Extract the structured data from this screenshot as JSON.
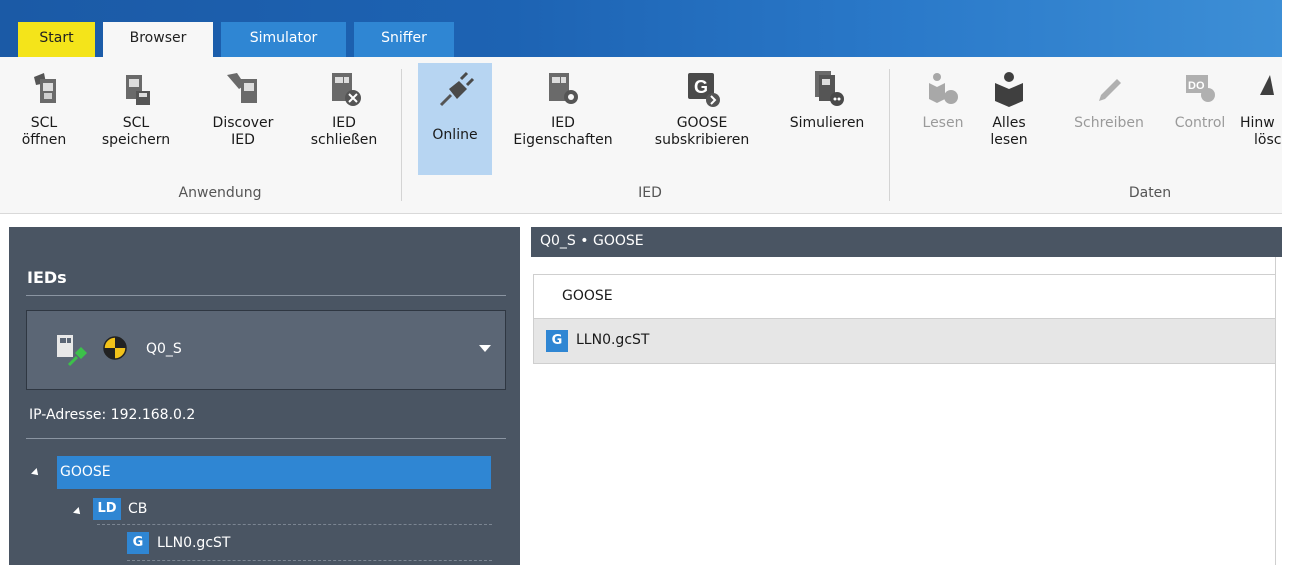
{
  "tabs": [
    "Start",
    "Browser",
    "Simulator",
    "Sniffer"
  ],
  "ribbon": {
    "anwendung": {
      "group_label": "Anwendung",
      "buttons": [
        {
          "icon": "open-scl-icon",
          "line1": "SCL",
          "line2": "öffnen"
        },
        {
          "icon": "save-scl-icon",
          "line1": "SCL",
          "line2": "speichern"
        },
        {
          "icon": "discover-ied-icon",
          "line1": "Discover",
          "line2": "IED"
        },
        {
          "icon": "close-ied-icon",
          "line1": "IED",
          "line2": "schließen"
        }
      ]
    },
    "ied": {
      "group_label": "IED",
      "buttons": [
        {
          "icon": "plug-icon",
          "line1": "Online",
          "line2": ""
        },
        {
          "icon": "ied-properties-icon",
          "line1": "IED",
          "line2": "Eigenschaften"
        },
        {
          "icon": "goose-subscribe-icon",
          "line1": "GOOSE",
          "line2": "subskribieren"
        },
        {
          "icon": "simulate-icon",
          "line1": "Simulieren",
          "line2": ""
        }
      ]
    },
    "daten": {
      "group_label": "Daten",
      "buttons": [
        {
          "icon": "read-icon",
          "line1": "Lesen",
          "line2": ""
        },
        {
          "icon": "read-all-icon",
          "line1": "Alles",
          "line2": "lesen"
        },
        {
          "icon": "write-icon",
          "line1": "Schreiben",
          "line2": ""
        },
        {
          "icon": "control-icon",
          "line1": "Control",
          "line2": ""
        },
        {
          "icon": "delete-hints-icon",
          "line1": "Hinw",
          "line2": "lösc"
        }
      ]
    }
  },
  "left": {
    "title": "IEDs",
    "selected_ied": "Q0_S",
    "ip_label": "IP-Adresse:",
    "ip_value": "192.168.0.2",
    "tree": {
      "root": "GOOSE",
      "ld_badge": "LD",
      "ld_label": "CB",
      "g_badge": "G",
      "g_label": "LLN0.gcST"
    }
  },
  "right": {
    "breadcrumb": "Q0_S • GOOSE",
    "column_header": "GOOSE",
    "row_badge": "G",
    "row_label": "LLN0.gcST"
  },
  "colors": {
    "accent": "#2f86d3",
    "start_tab": "#f4e41a",
    "panel": "#4a5563"
  }
}
